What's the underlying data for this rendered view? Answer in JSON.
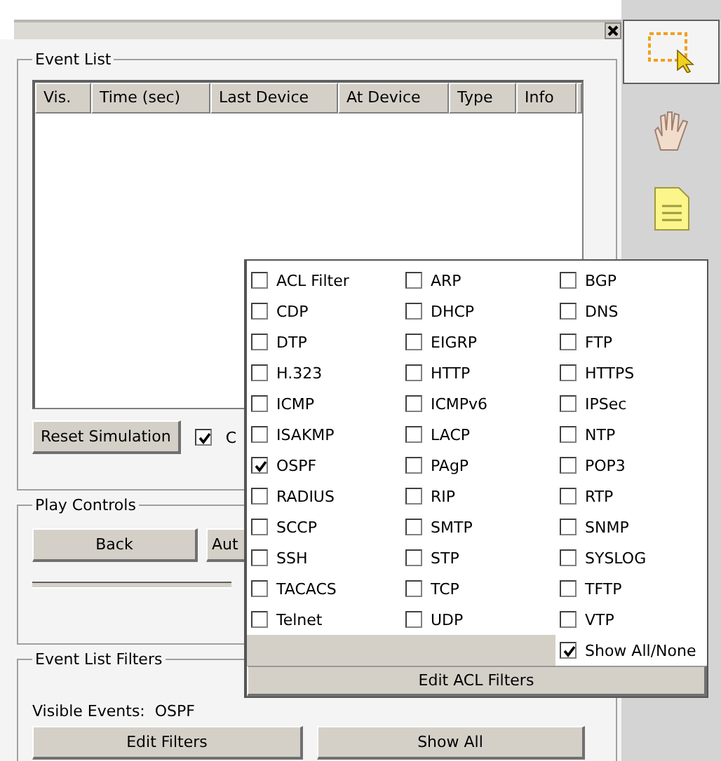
{
  "event_list": {
    "title": "Event List",
    "columns": [
      "Vis.",
      "Time (sec)",
      "Last Device",
      "At Device",
      "Type",
      "Info"
    ],
    "reset_button": "Reset Simulation",
    "checkbox": {
      "label": "C",
      "checked": true
    }
  },
  "play_controls": {
    "title": "Play Controls",
    "back_button": "Back",
    "auto_button": "Aut"
  },
  "event_list_filters": {
    "title": "Event List Filters",
    "visible_events": "Visible Events:  OSPF",
    "edit_button": "Edit Filters",
    "show_all_button": "Show All"
  },
  "toolbar": {
    "tools": [
      {
        "kind": "select",
        "selected": true
      },
      {
        "kind": "hand",
        "selected": false
      },
      {
        "kind": "note",
        "selected": false
      }
    ]
  },
  "filter_popup": {
    "protocols": [
      {
        "label": "ACL Filter",
        "checked": false
      },
      {
        "label": "ARP",
        "checked": false
      },
      {
        "label": "BGP",
        "checked": false
      },
      {
        "label": "CDP",
        "checked": false
      },
      {
        "label": "DHCP",
        "checked": false
      },
      {
        "label": "DNS",
        "checked": false
      },
      {
        "label": "DTP",
        "checked": false
      },
      {
        "label": "EIGRP",
        "checked": false
      },
      {
        "label": "FTP",
        "checked": false
      },
      {
        "label": "H.323",
        "checked": false
      },
      {
        "label": "HTTP",
        "checked": false
      },
      {
        "label": "HTTPS",
        "checked": false
      },
      {
        "label": "ICMP",
        "checked": false
      },
      {
        "label": "ICMPv6",
        "checked": false
      },
      {
        "label": "IPSec",
        "checked": false
      },
      {
        "label": "ISAKMP",
        "checked": false
      },
      {
        "label": "LACP",
        "checked": false
      },
      {
        "label": "NTP",
        "checked": false
      },
      {
        "label": "OSPF",
        "checked": true
      },
      {
        "label": "PAgP",
        "checked": false
      },
      {
        "label": "POP3",
        "checked": false
      },
      {
        "label": "RADIUS",
        "checked": false
      },
      {
        "label": "RIP",
        "checked": false
      },
      {
        "label": "RTP",
        "checked": false
      },
      {
        "label": "SCCP",
        "checked": false
      },
      {
        "label": "SMTP",
        "checked": false
      },
      {
        "label": "SNMP",
        "checked": false
      },
      {
        "label": "SSH",
        "checked": false
      },
      {
        "label": "STP",
        "checked": false
      },
      {
        "label": "SYSLOG",
        "checked": false
      },
      {
        "label": "TACACS",
        "checked": false
      },
      {
        "label": "TCP",
        "checked": false
      },
      {
        "label": "TFTP",
        "checked": false
      },
      {
        "label": "Telnet",
        "checked": false
      },
      {
        "label": "UDP",
        "checked": false
      },
      {
        "label": "VTP",
        "checked": false
      }
    ],
    "show_all_none": {
      "label": "Show All/None",
      "checked": true
    },
    "edit_acl_button": "Edit ACL Filters"
  }
}
